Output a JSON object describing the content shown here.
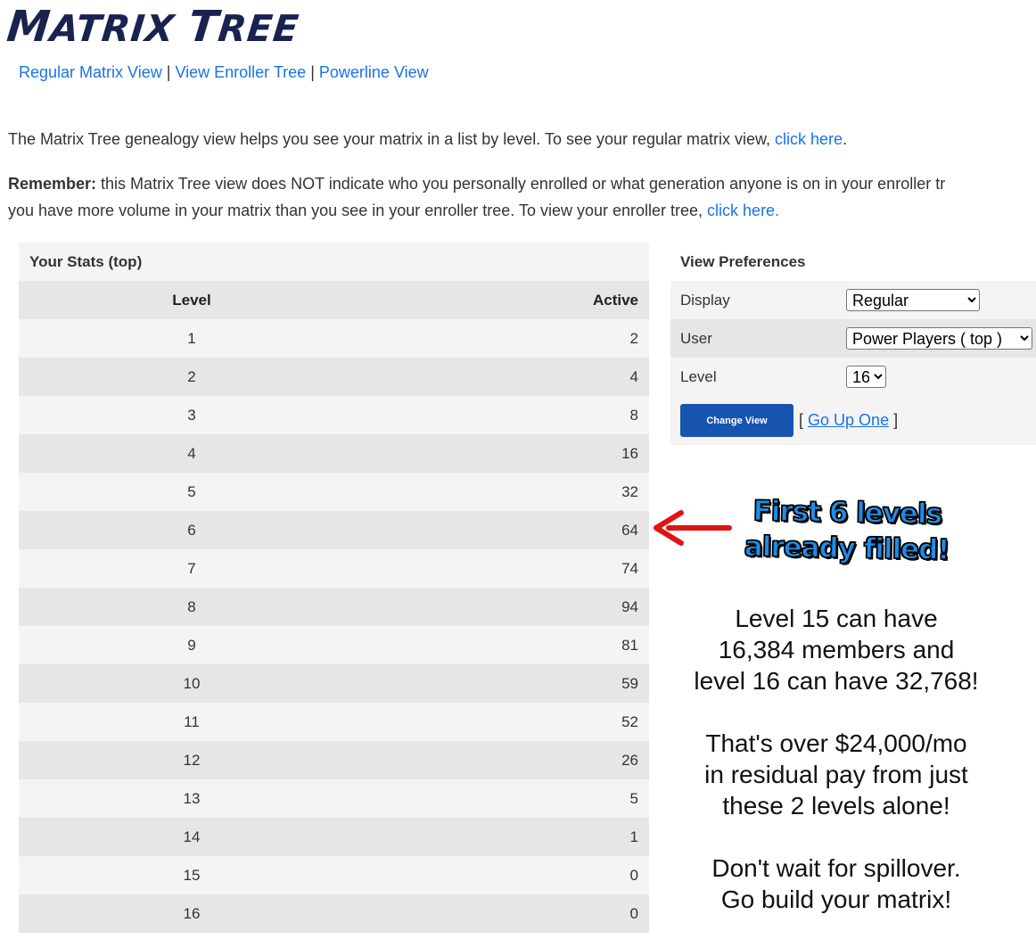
{
  "logo": {
    "first_initial": "M",
    "first_rest": "ATRIX",
    "second_initial": "T",
    "second_rest": "REE"
  },
  "nav": [
    {
      "label": "Regular Matrix View"
    },
    {
      "label": "View Enroller Tree"
    },
    {
      "label": "Powerline View"
    }
  ],
  "nav_separator": "|",
  "intro": {
    "text": "The Matrix Tree genealogy view helps you see your matrix in a list by level. To see your regular matrix view, ",
    "link": "click here",
    "end": "."
  },
  "remember": {
    "bold": "Remember:",
    "line1": " this Matrix Tree view does NOT indicate who you personally enrolled or what generation anyone is on in your enroller tr",
    "line2": "you have more volume in your matrix than you see in your enroller tree. To view your enroller tree, ",
    "link": "click here."
  },
  "stats": {
    "caption": "Your Stats (top)",
    "col_level": "Level",
    "col_active": "Active",
    "rows": [
      {
        "level": "1",
        "active": "2"
      },
      {
        "level": "2",
        "active": "4"
      },
      {
        "level": "3",
        "active": "8"
      },
      {
        "level": "4",
        "active": "16"
      },
      {
        "level": "5",
        "active": "32"
      },
      {
        "level": "6",
        "active": "64"
      },
      {
        "level": "7",
        "active": "74"
      },
      {
        "level": "8",
        "active": "94"
      },
      {
        "level": "9",
        "active": "81"
      },
      {
        "level": "10",
        "active": "59"
      },
      {
        "level": "11",
        "active": "52"
      },
      {
        "level": "12",
        "active": "26"
      },
      {
        "level": "13",
        "active": "5"
      },
      {
        "level": "14",
        "active": "1"
      },
      {
        "level": "15",
        "active": "0"
      },
      {
        "level": "16",
        "active": "0"
      }
    ]
  },
  "prefs": {
    "title": "View Preferences",
    "display_label": "Display",
    "display_value": "Regular",
    "user_label": "User",
    "user_value": "Power Players ( top )",
    "level_label": "Level",
    "level_value": "16",
    "change_button": "Change View",
    "go_up_open": "[",
    "go_up_link": "Go Up One",
    "go_up_close": "]"
  },
  "callout": {
    "line1": "First 6 levels",
    "line2": "already filled!",
    "color": "#1e8de8"
  },
  "arrow_color": "#e01414",
  "note": {
    "p1": [
      "Level 15 can have",
      "16,384 members and",
      "level 16 can have 32,768!"
    ],
    "p2": [
      "That's over $24,000/mo",
      "in residual pay from just",
      "these 2 levels alone!"
    ],
    "p3": [
      "Don't wait for spillover.",
      "Go build your matrix!"
    ]
  },
  "icons": {
    "dropdown": "chevron-down-icon",
    "arrow": "left-arrow-icon"
  }
}
